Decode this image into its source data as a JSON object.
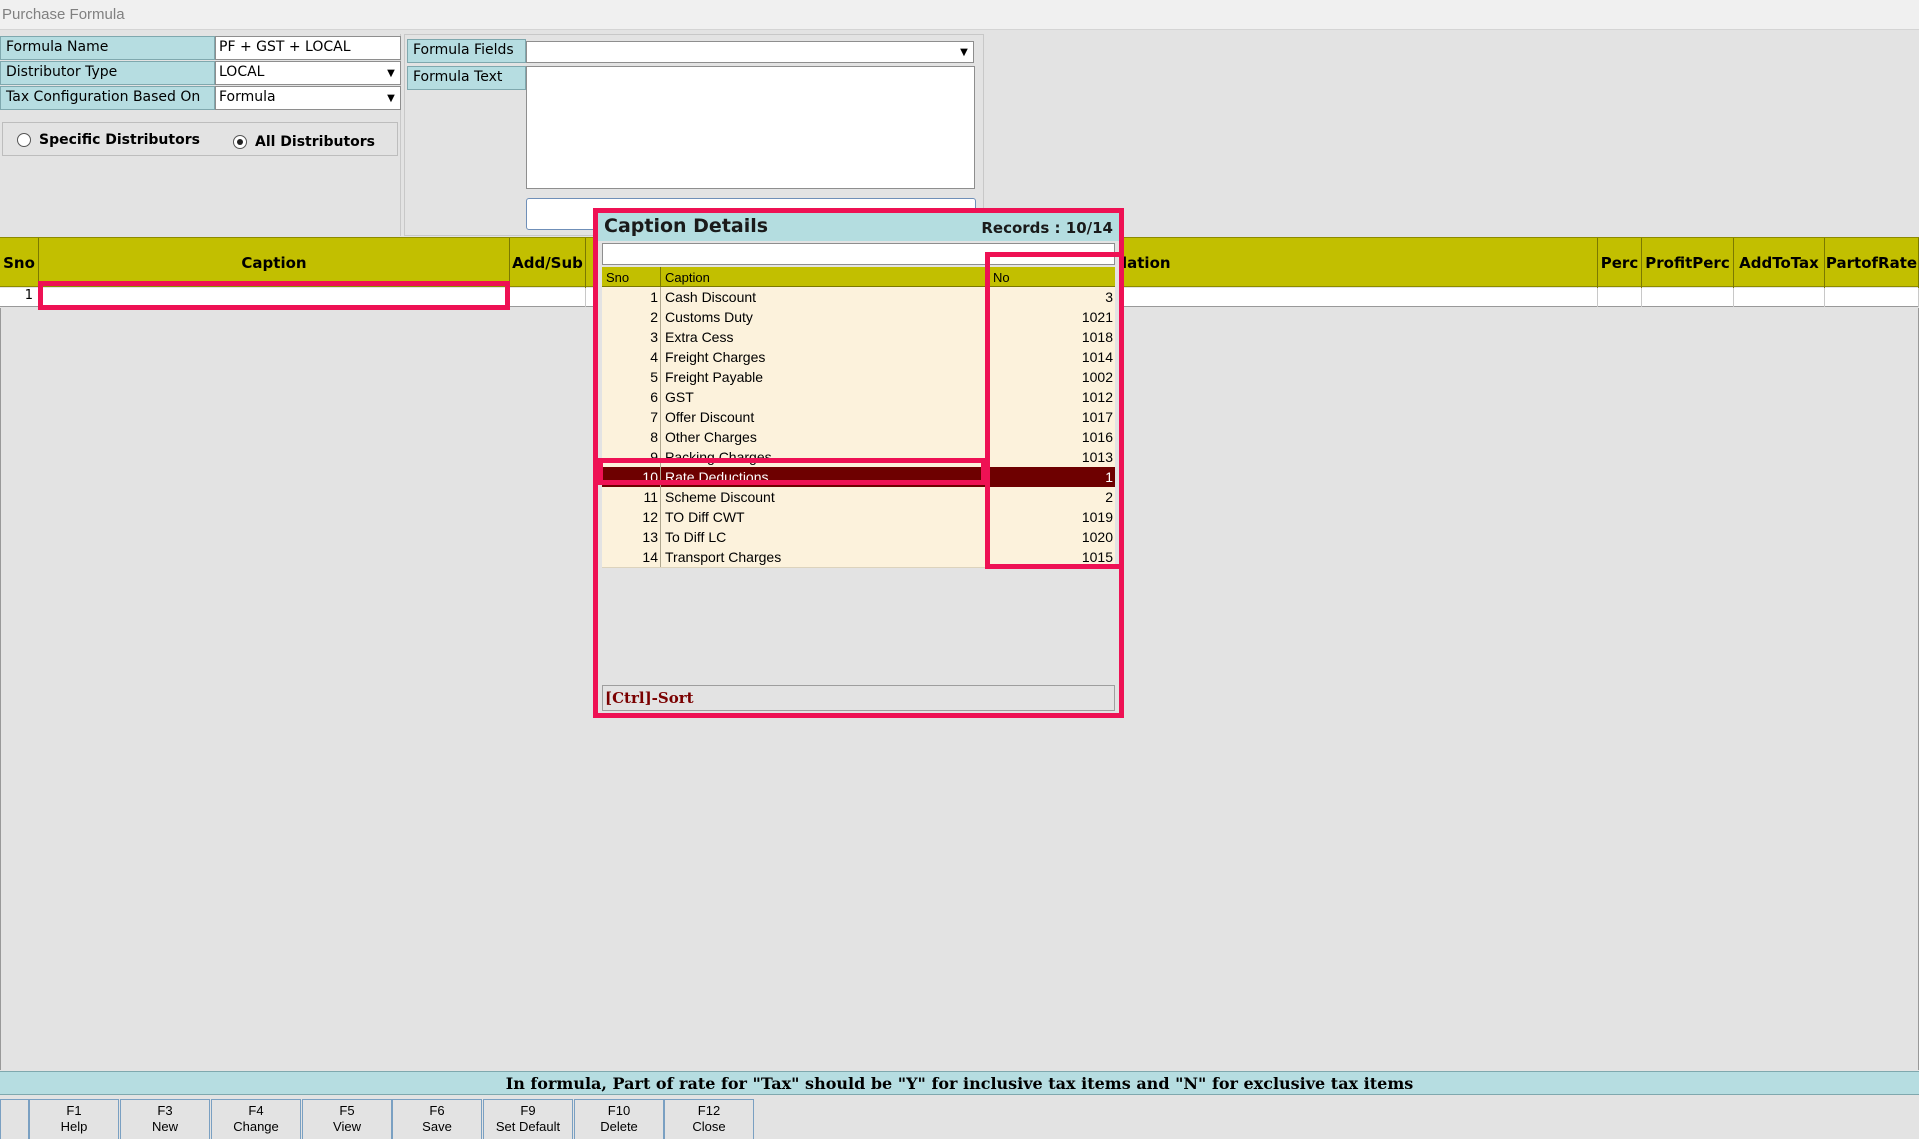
{
  "window": {
    "title": "Purchase Formula"
  },
  "form": {
    "formula_name_label": "Formula Name",
    "formula_name_value": "PF + GST + LOCAL",
    "distributor_type_label": "Distributor Type",
    "distributor_type_value": "LOCAL",
    "tax_config_label": "Tax Configuration Based On",
    "tax_config_value": "Formula",
    "radio_specific": "Specific Distributors",
    "radio_all": "All Distributors",
    "radio_selected": "All Distributors",
    "formula_fields_label": "Formula Fields",
    "formula_fields_value": "",
    "formula_text_label": "Formula Text",
    "formula_text_value": ""
  },
  "grid": {
    "columns": [
      "Sno",
      "Caption",
      "Add/Sub",
      "Calculation",
      "Perc",
      "ProfitPerc",
      "AddToTax",
      "PartofRate"
    ],
    "visible_calc_label": "lation",
    "rows": [
      {
        "sno": "1",
        "caption": ""
      }
    ]
  },
  "popup": {
    "title": "Caption Details",
    "records": "Records : 10/14",
    "search_value": "",
    "columns": [
      "Sno",
      "Caption",
      "No"
    ],
    "selected_index": 9,
    "rows": [
      {
        "sno": "1",
        "caption": "Cash Discount",
        "no": "3"
      },
      {
        "sno": "2",
        "caption": "Customs Duty",
        "no": "1021"
      },
      {
        "sno": "3",
        "caption": "Extra Cess",
        "no": "1018"
      },
      {
        "sno": "4",
        "caption": "Freight Charges",
        "no": "1014"
      },
      {
        "sno": "5",
        "caption": "Freight Payable",
        "no": "1002"
      },
      {
        "sno": "6",
        "caption": "GST",
        "no": "1012"
      },
      {
        "sno": "7",
        "caption": "Offer Discount",
        "no": "1017"
      },
      {
        "sno": "8",
        "caption": "Other Charges",
        "no": "1016"
      },
      {
        "sno": "9",
        "caption": "Packing Charges",
        "no": "1013"
      },
      {
        "sno": "10",
        "caption": "Rate Deductions",
        "no": "1"
      },
      {
        "sno": "11",
        "caption": "Scheme Discount",
        "no": "2"
      },
      {
        "sno": "12",
        "caption": "TO Diff CWT",
        "no": "1019"
      },
      {
        "sno": "13",
        "caption": "To Diff LC",
        "no": "1020"
      },
      {
        "sno": "14",
        "caption": "Transport Charges",
        "no": "1015"
      }
    ],
    "footer": "[Ctrl]-Sort"
  },
  "status": {
    "message": "In formula, Part of rate for \"Tax\" should be \"Y\" for inclusive tax items and \"N\" for exclusive tax items"
  },
  "function_keys": [
    {
      "key": "F1",
      "label": "Help"
    },
    {
      "key": "F3",
      "label": "New"
    },
    {
      "key": "F4",
      "label": "Change"
    },
    {
      "key": "F5",
      "label": "View"
    },
    {
      "key": "F6",
      "label": "Save"
    },
    {
      "key": "F9",
      "label": "Set Default"
    },
    {
      "key": "F10",
      "label": "Delete"
    },
    {
      "key": "F12",
      "label": "Close"
    }
  ],
  "colors": {
    "header_olive": "#c2bf00",
    "label_teal": "#b6dde1",
    "highlight_red": "#ee1154",
    "selected_row": "#6e0000",
    "row_cream": "#fcf2dc"
  }
}
